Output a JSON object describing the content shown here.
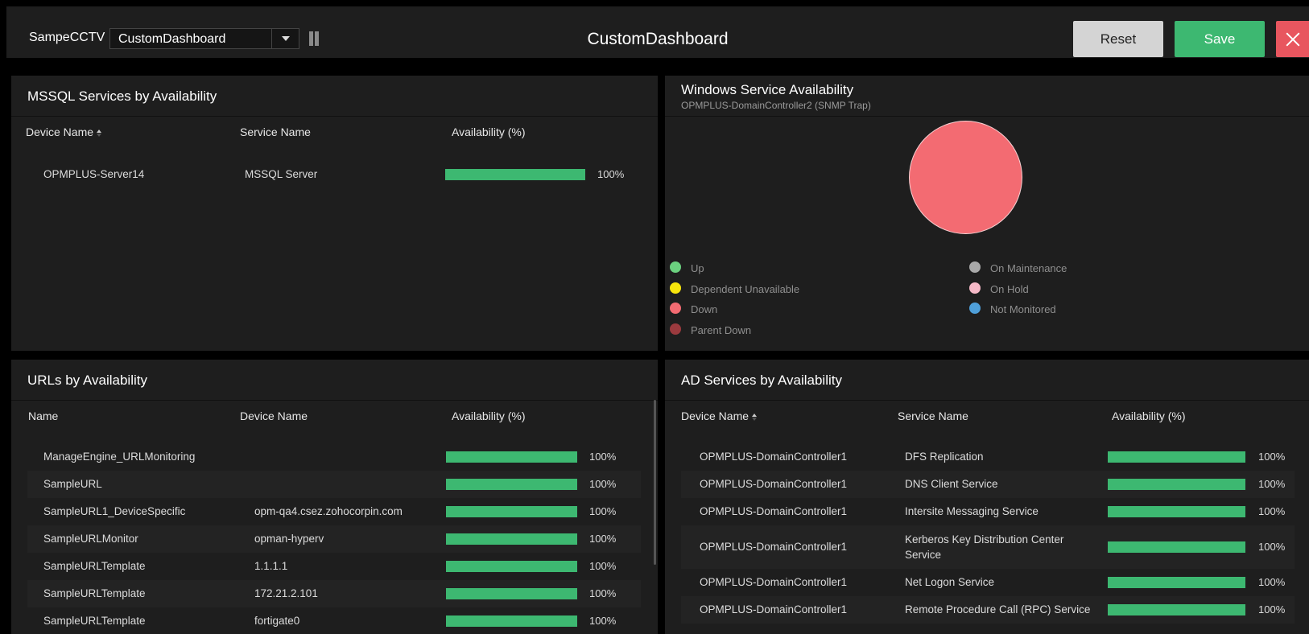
{
  "topbar": {
    "brand": "SampeCCTV",
    "dashboard_select": "CustomDashboard",
    "title": "CustomDashboard",
    "reset_label": "Reset",
    "save_label": "Save"
  },
  "mssql": {
    "title": "MSSQL Services by Availability",
    "columns": [
      "Device Name",
      "Service Name",
      "Availability (%)"
    ],
    "rows": [
      {
        "device": "OPMPLUS-Server14",
        "service": "MSSQL Server",
        "availability": 100,
        "pct": "100%"
      }
    ]
  },
  "windows": {
    "title": "Windows Service Availability",
    "subtitle": "OPMPLUS-DomainController2 (SNMP Trap)",
    "chart_data": {
      "type": "pie",
      "categories": [
        "Up",
        "Dependent Unavailable",
        "Down",
        "Parent Down",
        "On Maintenance",
        "On Hold",
        "Not Monitored"
      ],
      "values": [
        0,
        0,
        1,
        0,
        0,
        0,
        0
      ]
    },
    "legend": [
      {
        "label": "Up",
        "color": "#6bd17f"
      },
      {
        "label": "Dependent Unavailable",
        "color": "#f7e50c"
      },
      {
        "label": "Down",
        "color": "#f36b72"
      },
      {
        "label": "Parent Down",
        "color": "#9b3a3e"
      },
      {
        "label": "On Maintenance",
        "color": "#a9a9a9"
      },
      {
        "label": "On Hold",
        "color": "#f6b9c7"
      },
      {
        "label": "Not Monitored",
        "color": "#4f9fd9"
      }
    ]
  },
  "urls": {
    "title": "URLs by Availability",
    "columns": [
      "Name",
      "Device Name",
      "Availability (%)"
    ],
    "rows": [
      {
        "name": "ManageEngine_URLMonitoring",
        "device": "",
        "availability": 100,
        "pct": "100%"
      },
      {
        "name": "SampleURL",
        "device": "",
        "availability": 100,
        "pct": "100%"
      },
      {
        "name": "SampleURL1_DeviceSpecific",
        "device": "opm-qa4.csez.zohocorpin.com",
        "availability": 100,
        "pct": "100%"
      },
      {
        "name": "SampleURLMonitor",
        "device": "opman-hyperv",
        "availability": 100,
        "pct": "100%"
      },
      {
        "name": "SampleURLTemplate",
        "device": "1.1.1.1",
        "availability": 100,
        "pct": "100%"
      },
      {
        "name": "SampleURLTemplate",
        "device": "172.21.2.101",
        "availability": 100,
        "pct": "100%"
      },
      {
        "name": "SampleURLTemplate",
        "device": "fortigate0",
        "availability": 100,
        "pct": "100%"
      }
    ]
  },
  "ad": {
    "title": "AD Services by Availability",
    "columns": [
      "Device Name",
      "Service Name",
      "Availability (%)"
    ],
    "rows": [
      {
        "device": "OPMPLUS-DomainController1",
        "service": "DFS Replication",
        "availability": 100,
        "pct": "100%"
      },
      {
        "device": "OPMPLUS-DomainController1",
        "service": "DNS Client Service",
        "availability": 100,
        "pct": "100%"
      },
      {
        "device": "OPMPLUS-DomainController1",
        "service": "Intersite Messaging Service",
        "availability": 100,
        "pct": "100%"
      },
      {
        "device": "OPMPLUS-DomainController1",
        "service": "Kerberos Key Distribution Center Service",
        "availability": 100,
        "pct": "100%"
      },
      {
        "device": "OPMPLUS-DomainController1",
        "service": "Net Logon Service",
        "availability": 100,
        "pct": "100%"
      },
      {
        "device": "OPMPLUS-DomainController1",
        "service": "Remote Procedure Call (RPC) Service",
        "availability": 100,
        "pct": "100%"
      }
    ]
  }
}
